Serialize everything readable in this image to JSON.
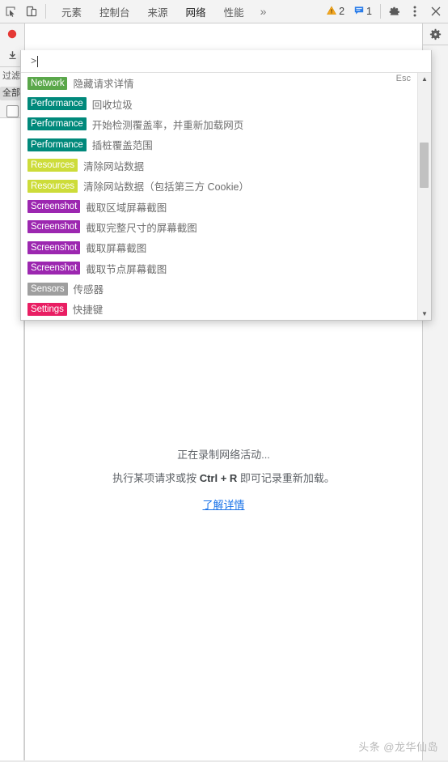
{
  "toolbar": {
    "inspect_icon": "inspect-cursor-icon",
    "device_icon": "device-toggle-icon",
    "tabs": [
      {
        "label": "元素",
        "active": false
      },
      {
        "label": "控制台",
        "active": false
      },
      {
        "label": "来源",
        "active": false
      },
      {
        "label": "网络",
        "active": true
      },
      {
        "label": "性能",
        "active": false
      }
    ],
    "more_tabs_label": "»",
    "warning_count": "2",
    "message_count": "1",
    "settings_icon": "gear-icon",
    "menu_icon": "kebab-menu-icon",
    "close_icon": "close-icon"
  },
  "network_sidebar": {
    "record_icon": "record-button-icon",
    "import_icon": "import-har-icon",
    "filter_label": "过滤",
    "all_label": "全部",
    "checkbox_checked": false
  },
  "right_rail": {
    "settings_icon": "gear-icon"
  },
  "palette": {
    "prompt": ">",
    "placeholder": "",
    "value": "",
    "esc_hint": "Esc",
    "scroll_up_icon": "caret-up-icon",
    "scroll_down_icon": "caret-down-icon",
    "tag_colors": {
      "Network": "#5aa74a",
      "Performance": "#00897b",
      "Resources": "#cddc39",
      "Screenshot": "#9c27b0",
      "Sensors": "#9e9e9e",
      "Settings": "#e91e63"
    },
    "items": [
      {
        "tag": "Network",
        "text": "隐藏请求详情"
      },
      {
        "tag": "Performance",
        "text": "回收垃圾"
      },
      {
        "tag": "Performance",
        "text": "开始检测覆盖率，并重新加载网页"
      },
      {
        "tag": "Performance",
        "text": "插桩覆盖范围"
      },
      {
        "tag": "Resources",
        "text": "清除网站数据"
      },
      {
        "tag": "Resources",
        "text": "清除网站数据（包括第三方 Cookie）"
      },
      {
        "tag": "Screenshot",
        "text": "截取区域屏幕截图"
      },
      {
        "tag": "Screenshot",
        "text": "截取完整尺寸的屏幕截图"
      },
      {
        "tag": "Screenshot",
        "text": "截取屏幕截图"
      },
      {
        "tag": "Screenshot",
        "text": "截取节点屏幕截图"
      },
      {
        "tag": "Sensors",
        "text": "传感器"
      },
      {
        "tag": "Settings",
        "text": "快捷键"
      }
    ]
  },
  "empty_state": {
    "line1": "正在录制网络活动...",
    "line2_prefix": "执行某项请求或按 ",
    "line2_shortcut": "Ctrl + R",
    "line2_suffix": " 即可记录重新加载。",
    "link": "了解详情"
  },
  "watermark": {
    "text": "头条 @龙华仙岛"
  }
}
